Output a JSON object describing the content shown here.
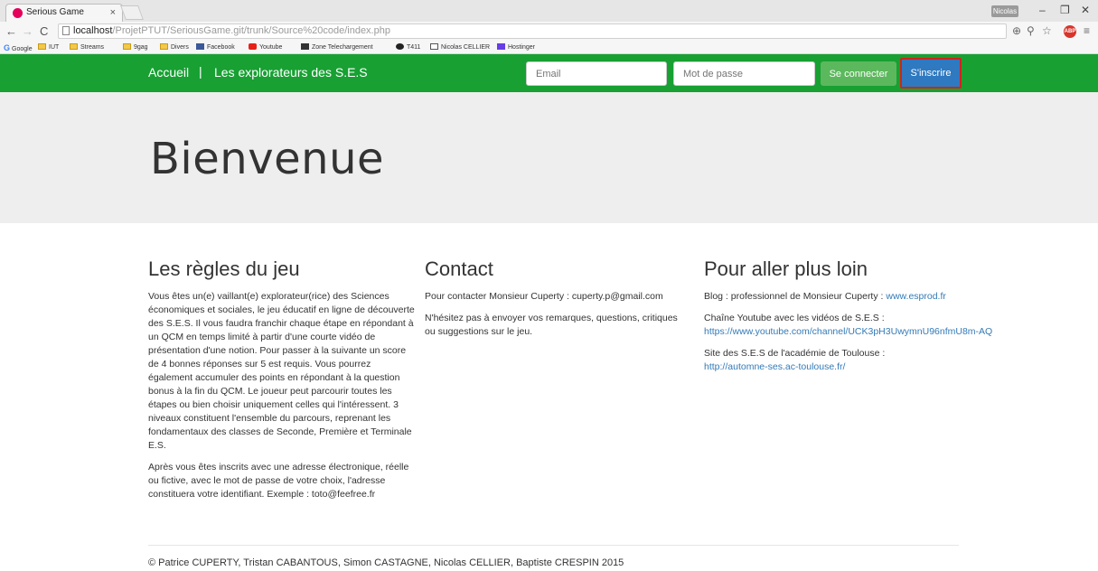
{
  "browser": {
    "tab_title": "Serious Game",
    "tab_close": "×",
    "profile": "Nicolas",
    "url_host": "localhost",
    "url_path": "/ProjetPTUT/SeriousGame.git/trunk/Source%20code/index.php",
    "bookmarks": [
      {
        "label": "Google",
        "icon": "google-icon"
      },
      {
        "label": "IUT",
        "icon": "folder-icon"
      },
      {
        "label": "Streams",
        "icon": "folder-icon"
      },
      {
        "label": "9gag",
        "icon": "folder-icon"
      },
      {
        "label": "Divers",
        "icon": "folder-icon"
      },
      {
        "label": "Facebook",
        "icon": "facebook-icon"
      },
      {
        "label": "Youtube",
        "icon": "youtube-icon"
      },
      {
        "label": "Zone Telechargement",
        "icon": "zt-icon"
      },
      {
        "label": "T411",
        "icon": "t411-icon"
      },
      {
        "label": "Nicolas CELLIER",
        "icon": "monitor-icon"
      },
      {
        "label": "Hostinger",
        "icon": "hostinger-icon"
      }
    ]
  },
  "navbar": {
    "home": "Accueil",
    "separator": "|",
    "brand": "Les explorateurs des S.E.S",
    "email_placeholder": "Email",
    "password_placeholder": "Mot de passe",
    "connect_label": "Se connecter",
    "signup_label": "S'inscrire",
    "colors": {
      "navbar": "#18a033",
      "connect": "#5cb85c",
      "signup": "#2e79c0",
      "highlight": "#d0241b"
    }
  },
  "jumbotron": {
    "title": "Bienvenue"
  },
  "rules": {
    "title": "Les règles du jeu",
    "p1": "Vous êtes un(e) vaillant(e) explorateur(rice) des Sciences économiques et sociales, le jeu éducatif en ligne de découverte des S.E.S. Il vous faudra franchir chaque étape en répondant à un QCM en temps limité à partir d'une courte vidéo de présentation d'une notion. Pour passer à la suivante un score de 4 bonnes réponses sur 5 est requis. Vous pourrez également accumuler des points en répondant à la question bonus à la fin du QCM. Le joueur peut parcourir toutes les étapes ou bien choisir uniquement celles qui l'intéressent. 3 niveaux constituent l'ensemble du parcours, reprenant les fondamentaux des classes de Seconde, Première et Terminale E.S.",
    "p2": "Après vous êtes inscrits avec une adresse électronique, réelle ou fictive, avec le mot de passe de votre choix, l'adresse constituera votre identifiant. Exemple : toto@feefree.fr"
  },
  "contact": {
    "title": "Contact",
    "p1": "Pour contacter Monsieur Cuperty : cuperty.p@gmail.com",
    "p2": "N'hésitez pas à envoyer vos remarques, questions, critiques ou suggestions sur le jeu."
  },
  "more": {
    "title": "Pour aller plus loin",
    "blog_text": "Blog : professionnel de Monsieur Cuperty : ",
    "blog_link": "www.esprod.fr",
    "youtube_text": "Chaîne Youtube avec les vidéos de S.E.S :",
    "youtube_link": "https://www.youtube.com/channel/UCK3pH3UwymnU96nfmU8m-AQ",
    "site_text": "Site des S.E.S de l'académie de Toulouse :",
    "site_link": "http://automne-ses.ac-toulouse.fr/"
  },
  "footer": {
    "text": "© Patrice CUPERTY, Tristan CABANTOUS, Simon CASTAGNE, Nicolas CELLIER, Baptiste CRESPIN 2015"
  }
}
